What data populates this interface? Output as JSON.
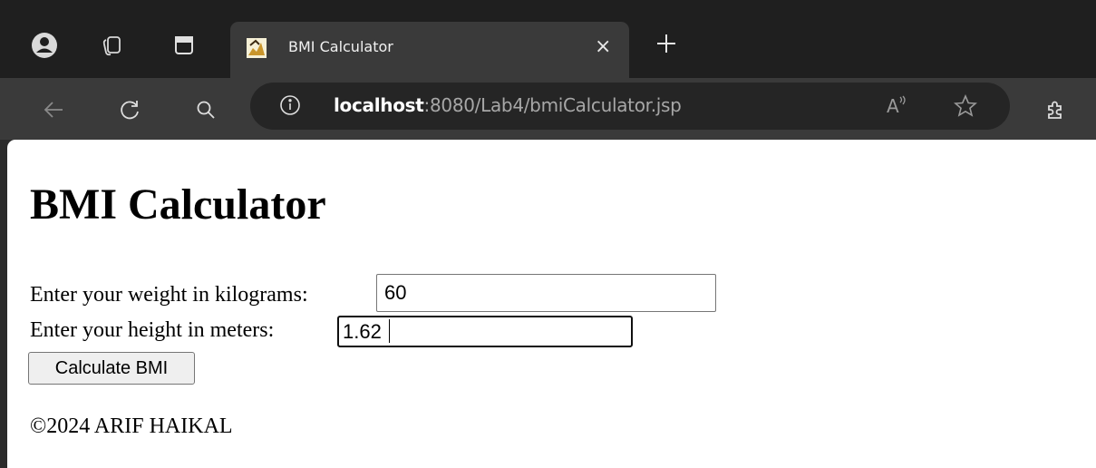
{
  "browser": {
    "tab": {
      "title": "BMI Calculator",
      "close_glyph": "×"
    },
    "new_tab_glyph": "+",
    "address": {
      "host": "localhost",
      "path": ":8080/Lab4/bmiCalculator.jsp"
    },
    "read_aloud_glyph": "A",
    "icons": [
      "profile-icon",
      "workspaces-icon",
      "tab-actions-icon",
      "favicon-icon",
      "back-icon",
      "refresh-icon",
      "search-icon",
      "site-info-icon",
      "read-aloud-icon",
      "favorite-star-icon",
      "extensions-icon"
    ]
  },
  "page": {
    "heading": "BMI Calculator",
    "weight": {
      "label": "Enter your weight in kilograms:",
      "value": "60"
    },
    "height": {
      "label": "Enter your height in meters:",
      "value": "1.62"
    },
    "submit_label": "Calculate BMI",
    "footer": "©2024 ARIF HAIKAL"
  }
}
